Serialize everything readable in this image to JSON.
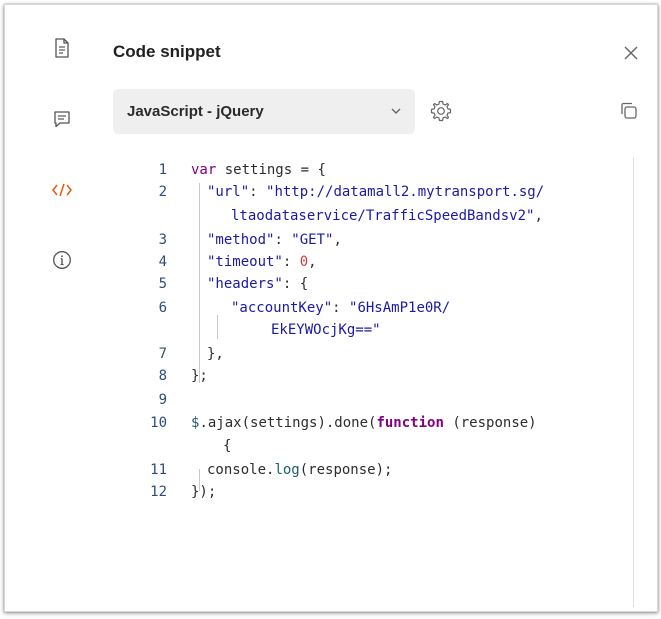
{
  "panel": {
    "title": "Code snippet",
    "language": "JavaScript - jQuery"
  },
  "rail": {
    "icons": [
      "document-icon",
      "comment-icon",
      "code-icon",
      "info-icon"
    ],
    "active_color": "#e8590c"
  },
  "code": {
    "lines": [
      {
        "n": "1",
        "tokens": [
          [
            "kw",
            "var"
          ],
          [
            "plain",
            " settings = {"
          ]
        ]
      },
      {
        "n": "2",
        "tokens": [
          [
            "key",
            "\"url\""
          ],
          [
            "plain",
            ": "
          ],
          [
            "str",
            "\"http://datamall2.mytransport.sg/"
          ]
        ]
      },
      {
        "n": "",
        "tokens": [
          [
            "str",
            "ltaodataservice/TrafficSpeedBandsv2\""
          ],
          [
            "plain",
            ","
          ]
        ]
      },
      {
        "n": "3",
        "tokens": [
          [
            "key",
            "\"method\""
          ],
          [
            "plain",
            ": "
          ],
          [
            "str",
            "\"GET\""
          ],
          [
            "plain",
            ","
          ]
        ]
      },
      {
        "n": "4",
        "tokens": [
          [
            "key",
            "\"timeout\""
          ],
          [
            "plain",
            ": "
          ],
          [
            "num",
            "0"
          ],
          [
            "plain",
            ","
          ]
        ]
      },
      {
        "n": "5",
        "tokens": [
          [
            "key",
            "\"headers\""
          ],
          [
            "plain",
            ": {"
          ]
        ]
      },
      {
        "n": "6",
        "tokens": [
          [
            "key",
            "\"accountKey\""
          ],
          [
            "plain",
            ": "
          ],
          [
            "str",
            "\"6HsAmP1e0R/"
          ]
        ]
      },
      {
        "n": "",
        "tokens": [
          [
            "str",
            "EkEYWOcjKg==\""
          ]
        ]
      },
      {
        "n": "7",
        "tokens": [
          [
            "plain",
            "},"
          ]
        ]
      },
      {
        "n": "8",
        "tokens": [
          [
            "plain",
            "};"
          ]
        ]
      },
      {
        "n": "9",
        "tokens": []
      },
      {
        "n": "10",
        "tokens": [
          [
            "obj",
            "$"
          ],
          [
            "plain",
            ".ajax(settings).done("
          ],
          [
            "kwb",
            "function"
          ],
          [
            "plain",
            " (response)"
          ]
        ]
      },
      {
        "n": "",
        "tokens": [
          [
            "plain",
            "{"
          ]
        ]
      },
      {
        "n": "11",
        "tokens": [
          [
            "plain",
            "console."
          ],
          [
            "fn",
            "log"
          ],
          [
            "plain",
            "(response);"
          ]
        ]
      },
      {
        "n": "12",
        "tokens": [
          [
            "plain",
            "});"
          ]
        ]
      }
    ]
  }
}
